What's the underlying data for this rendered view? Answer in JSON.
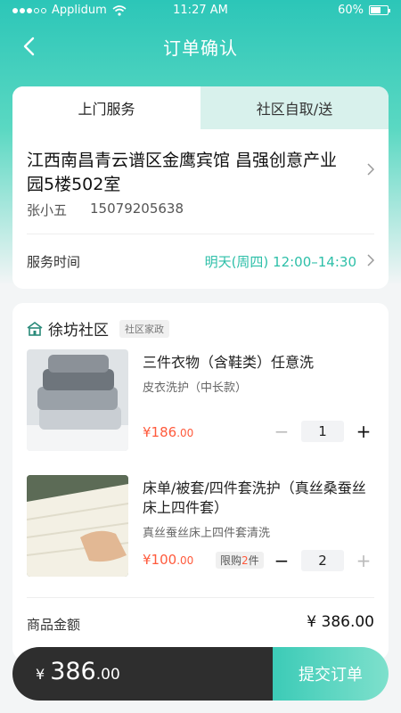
{
  "status_bar": {
    "carrier": "Applidum",
    "time": "11:27 AM",
    "battery": "60%",
    "battery_level": 0.6
  },
  "nav": {
    "title": "订单确认",
    "back_icon": "chevron-left-icon"
  },
  "tabs": [
    {
      "label": "上门服务",
      "active": true
    },
    {
      "label": "社区自取/送",
      "active": false
    }
  ],
  "address": {
    "text": "江西南昌青云谱区金鹰宾馆 昌强创意产业园5楼502室",
    "name": "张小五",
    "phone": "15079205638"
  },
  "service": {
    "label": "服务时间",
    "time": "明天(周四) 12:00–14:30"
  },
  "community": {
    "name": "徐坊社区",
    "tag": "社区家政",
    "icon": "community-icon"
  },
  "items": [
    {
      "title": "三件衣物（含鞋类）任意洗",
      "subtitle": "皮衣洗护（中长款）",
      "price_symbol": "¥",
      "price_int": "186",
      "price_cents": ".00",
      "quantity": "1",
      "image": "folded-sweaters-photo"
    },
    {
      "title": "床单/被套/四件套洗护（真丝桑蚕丝床上四件套）",
      "subtitle": "真丝蚕丝床上四件套清洗",
      "price_symbol": "¥",
      "price_int": "100",
      "price_cents": ".00",
      "limit_prefix": "限购",
      "limit_num": "2",
      "limit_suffix": "件",
      "quantity": "2",
      "image": "bed-sheet-photo"
    }
  ],
  "summary": {
    "label": "商品金额",
    "value": "¥ 386.00"
  },
  "footer": {
    "currency": "¥",
    "total_int": "386",
    "total_cents": ".00",
    "submit_label": "提交订单"
  },
  "colors": {
    "accent": "#2dbfa8",
    "price": "#ff5a3c",
    "dark": "#2e2e2e"
  }
}
